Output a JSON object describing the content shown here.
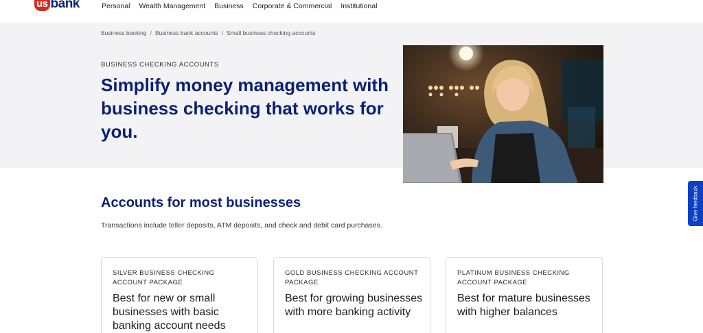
{
  "header": {
    "logo_us": "us",
    "logo_bank": "bank",
    "nav": [
      "Personal",
      "Wealth Management",
      "Business",
      "Corporate & Commercial",
      "Institutional"
    ]
  },
  "breadcrumb": [
    "Business banking",
    "Business bank accounts",
    "Small business checking accounts"
  ],
  "hero": {
    "eyebrow": "BUSINESS CHECKING ACCOUNTS",
    "title": "Simplify money management with business checking that works for you."
  },
  "accounts": {
    "title": "Accounts for most businesses",
    "description": "Transactions include teller deposits, ATM deposits, and check and debit card purchases.",
    "cards": [
      {
        "eyebrow": "SILVER BUSINESS CHECKING ACCOUNT PACKAGE",
        "title": "Best for new or small businesses with basic banking account needs"
      },
      {
        "eyebrow": "GOLD BUSINESS CHECKING ACCOUNT PACKAGE",
        "title": "Best for growing businesses with more banking activity"
      },
      {
        "eyebrow": "PLATINUM BUSINESS CHECKING ACCOUNT PACKAGE",
        "title": "Best for mature businesses with higher balances"
      }
    ]
  },
  "feedback": {
    "label": "Give feedback"
  },
  "colors": {
    "brand_red": "#d52b1e",
    "brand_navy": "#0c2074",
    "feedback_blue": "#0a41c5",
    "hero_bg": "#f3f3f6"
  },
  "icons": {
    "photo": "photo-woman-laptop"
  }
}
